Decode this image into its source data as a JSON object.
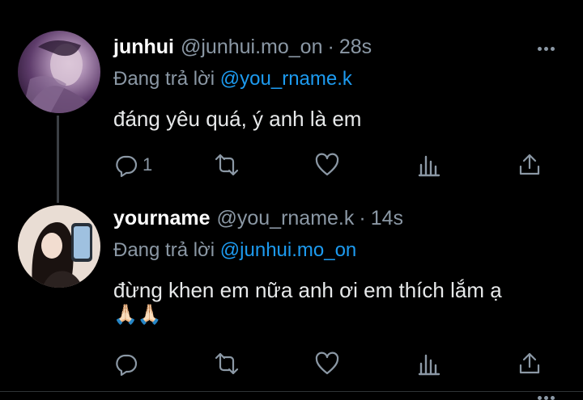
{
  "top_actions": [
    {
      "icon": "reply-icon"
    },
    {
      "icon": "retweet-icon"
    },
    {
      "icon": "like-icon"
    },
    {
      "icon": "views-icon"
    },
    {
      "icon": "share-icon"
    }
  ],
  "tweets": [
    {
      "name": "junhui",
      "handle": "@junhui.mo_on",
      "separator": "·",
      "time": "28s",
      "reply_prefix": "Đang trả lời",
      "reply_to": "@you_rname.k",
      "text": "đáng yêu quá, ý anh là em",
      "emoji": "",
      "reply_count": "1",
      "more_icon": "more-icon"
    },
    {
      "name": "yourname",
      "handle": "@you_rname.k",
      "separator": "·",
      "time": "14s",
      "reply_prefix": "Đang trả lời",
      "reply_to": "@junhui.mo_on",
      "text": "đừng khen em nữa anh ơi em thích lắm ạ",
      "emoji": "🙏🏻🙏🏻",
      "reply_count": "",
      "more_icon": "more-icon"
    }
  ],
  "colors": {
    "background": "#000000",
    "text": "#e7e9ea",
    "secondary": "#8b98a5",
    "link": "#1d9bf0",
    "thread_line": "#3b3f44"
  }
}
